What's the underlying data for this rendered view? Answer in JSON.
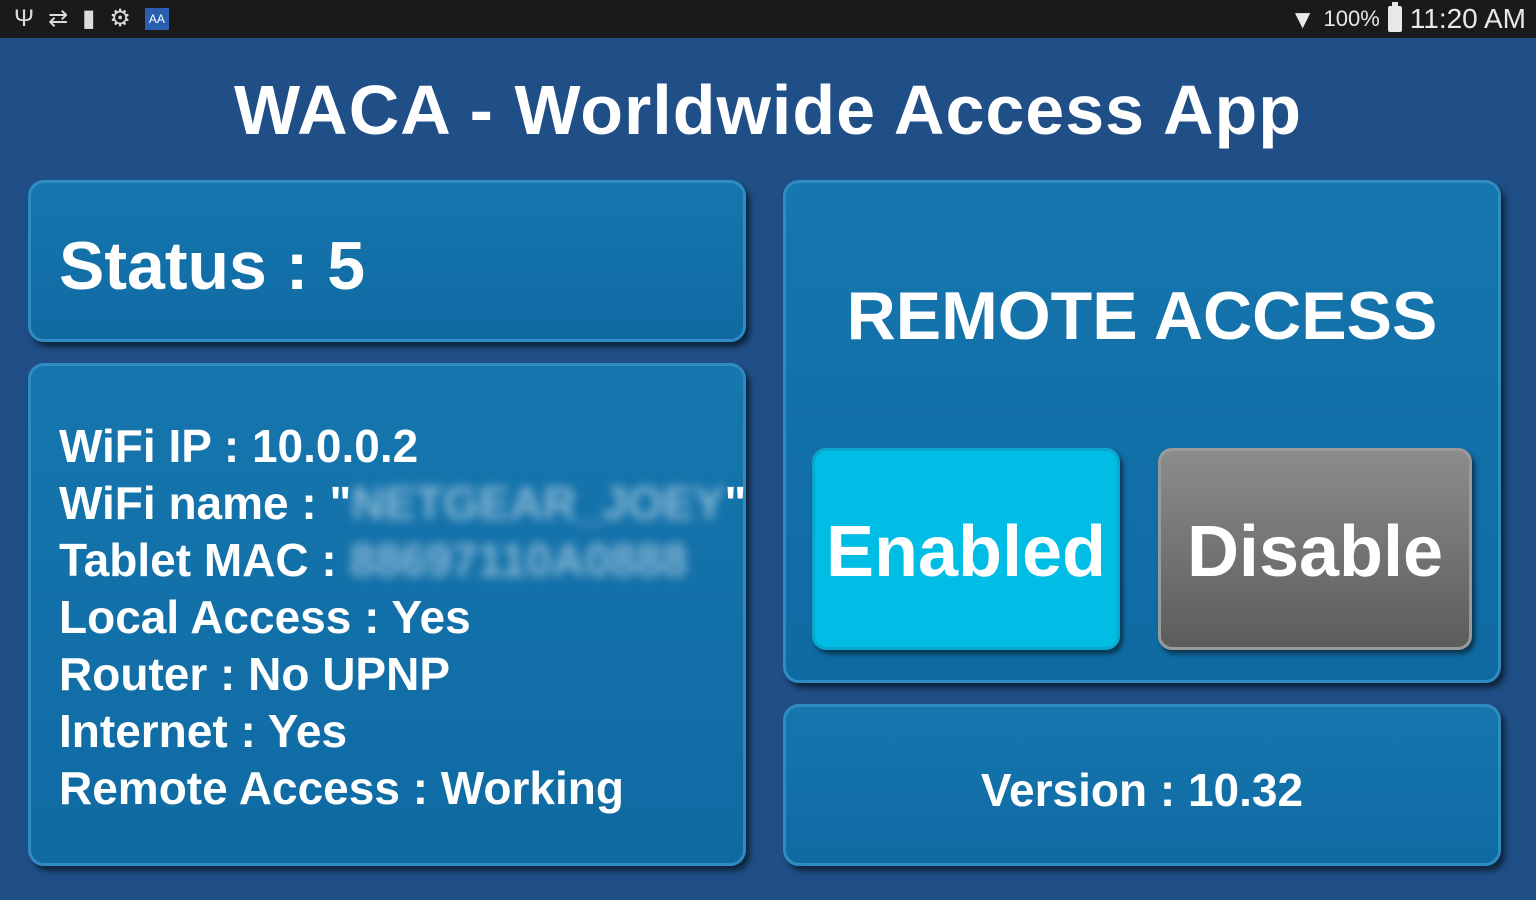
{
  "status_bar": {
    "left_icons": [
      "usb-icon",
      "sync-icon",
      "sd-card-icon",
      "android-icon",
      "app-notification-icon"
    ],
    "wifi_icon": "wifi-icon",
    "battery_percent": "100%",
    "time": "11:20 AM"
  },
  "app": {
    "title": "WACA - Worldwide Access App"
  },
  "status": {
    "text": "Status : 5"
  },
  "info": {
    "wifi_ip": "WiFi IP : 10.0.0.2",
    "wifi_name_label": "WiFi name : \"",
    "wifi_name_value": "NETGEAR_JOEY",
    "wifi_name_close": "\"",
    "tablet_mac_label": "Tablet MAC : ",
    "tablet_mac_value": "88697110A0888",
    "local_access": "Local Access : Yes",
    "router": "Router : No UPNP",
    "internet": "Internet : Yes",
    "remote_access": "Remote Access : Working"
  },
  "remote": {
    "title": "REMOTE ACCESS",
    "enabled_label": "Enabled",
    "disable_label": "Disable"
  },
  "version": {
    "text": "Version : 10.32"
  },
  "colors": {
    "background": "#1f4f86",
    "panel": "#1676ae",
    "enabled_button": "#00bde6",
    "disable_button": "#6e6e6e"
  }
}
